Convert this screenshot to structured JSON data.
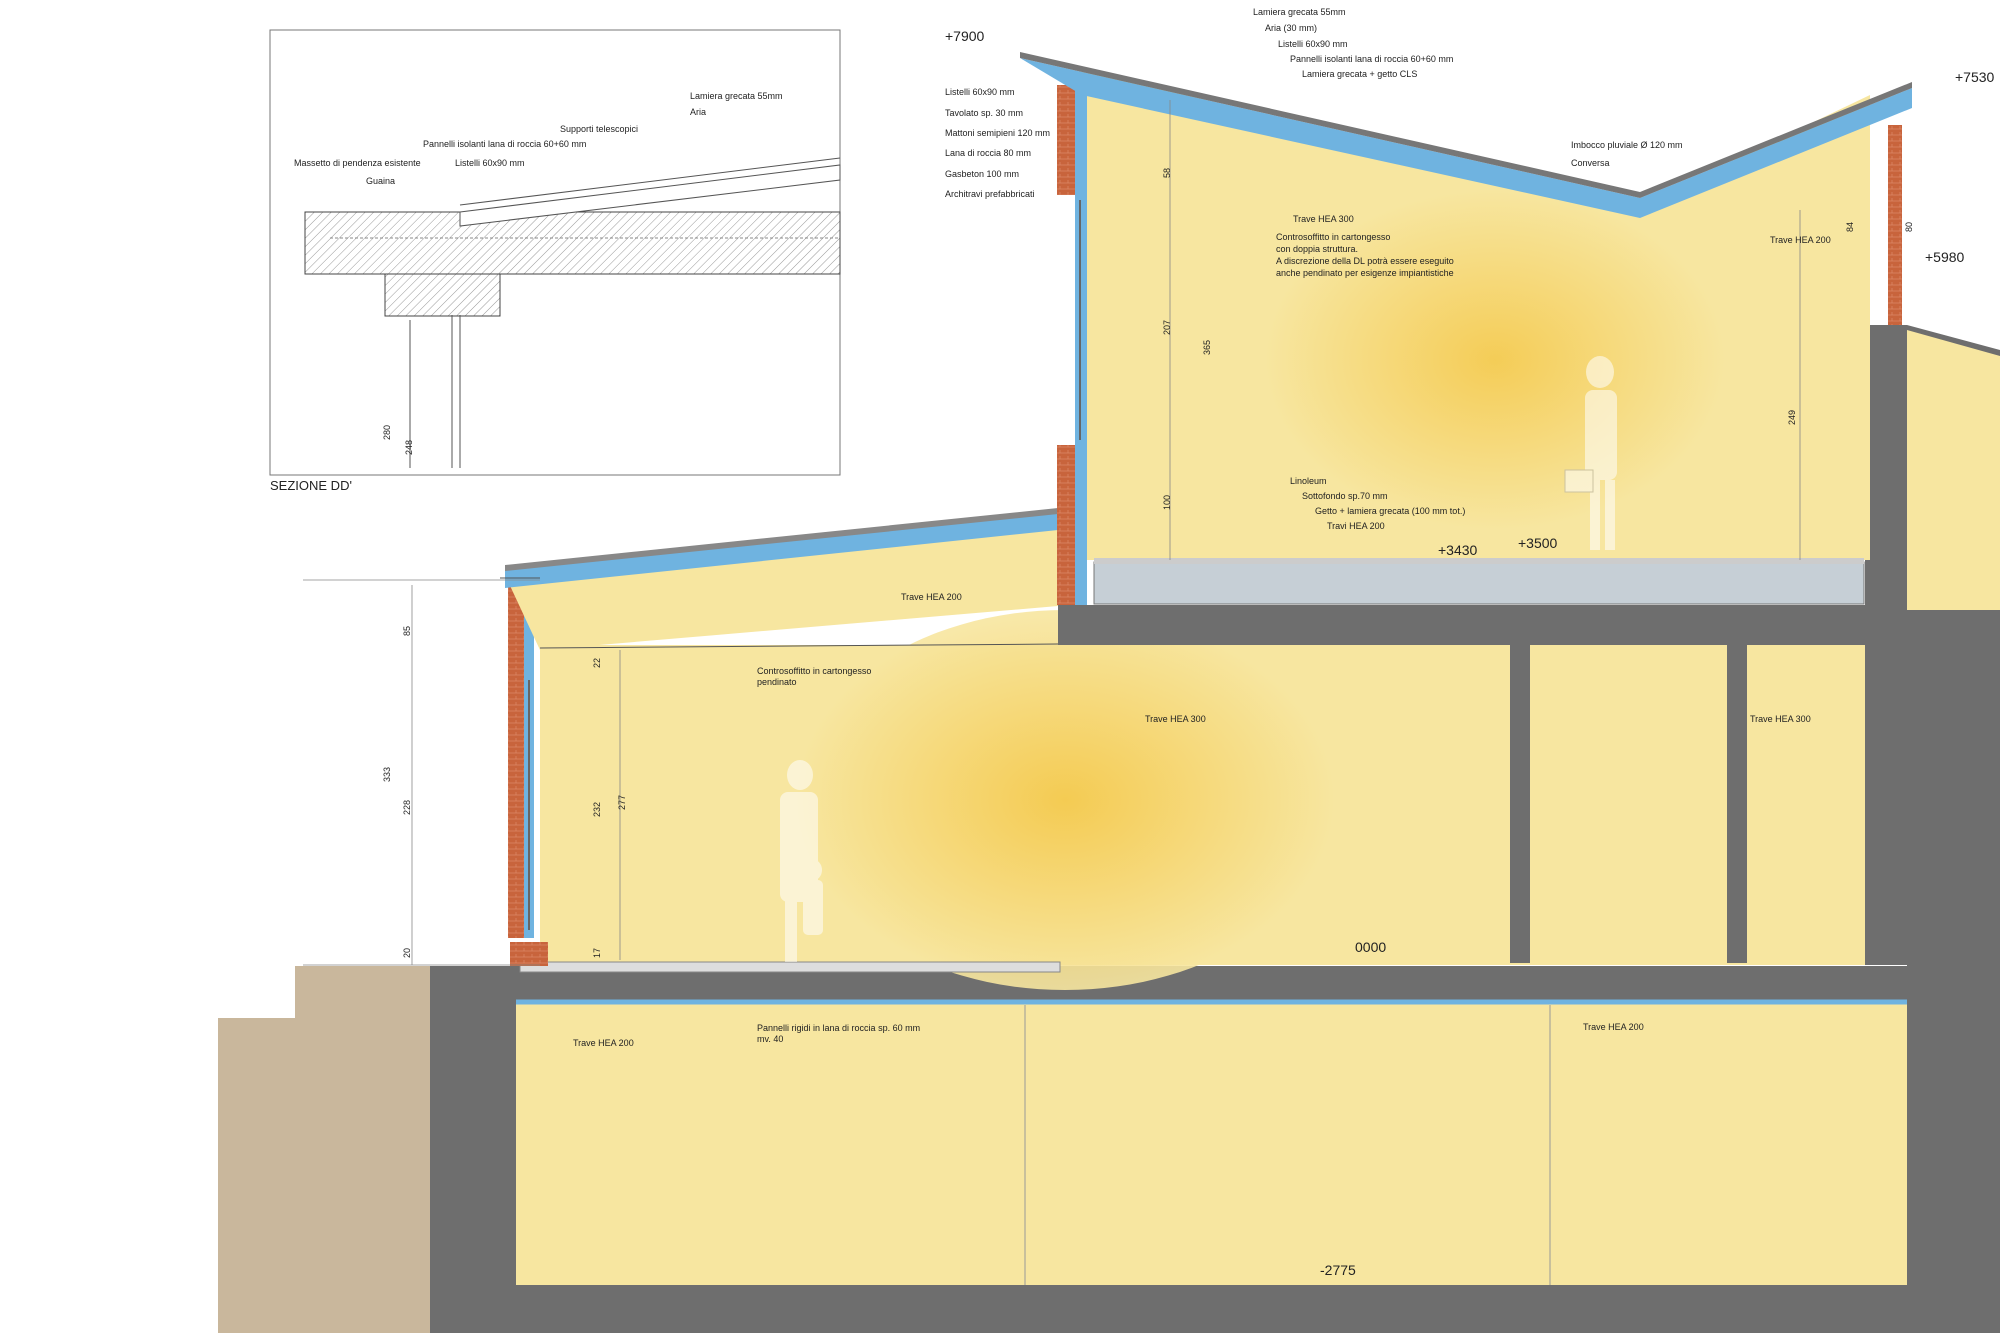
{
  "detail": {
    "title": "SEZIONE DD'",
    "labels": [
      "Lamiera grecata  55mm",
      "Aria",
      "Supporti telescopici",
      "Pannelli isolanti lana di roccia 60+60 mm",
      "Listelli 60x90 mm",
      "Massetto di pendenza esistente",
      "Guaina"
    ],
    "dims": [
      "280",
      "248"
    ]
  },
  "levels": [
    "+7900",
    "+7530",
    "+5980",
    "+3430",
    "+3500",
    "0000",
    "-2775"
  ],
  "roof_left_labels": [
    "Listelli 60x90 mm",
    "Tavolato sp. 30 mm",
    "Mattoni semipieni 120 mm",
    "Lana di roccia 80 mm",
    "Gasbeton 100 mm",
    "Architravi prefabbricati"
  ],
  "roof_top_labels": [
    "Lamiera grecata  55mm",
    "Aria (30 mm)",
    "Listelli 60x90 mm",
    "Pannelli isolanti lana di roccia 60+60 mm",
    "Lamiera grecata + getto CLS"
  ],
  "gutter_labels": [
    "Imbocco pluviale Ø 120 mm",
    "Conversa"
  ],
  "upper_room": {
    "beam_label": "Trave HEA 300",
    "ceiling_lines": [
      "Controsoffitto in cartongesso",
      "con doppia struttura.",
      "A discrezione della DL potrà essere eseguito",
      "anche pendinato per esigenze impiantistiche"
    ],
    "right_beam": "Trave HEA 200",
    "floor_labels": [
      "Linoleum",
      "Sottofondo sp.70 mm",
      "Getto + lamiera grecata (100 mm tot.)",
      "Travi HEA 200"
    ],
    "dims": [
      "58",
      "207",
      "365",
      "100",
      "249",
      "84",
      "80"
    ]
  },
  "lower_room": {
    "beam_label": "Trave HEA 200",
    "ceiling_lines": [
      "Controsoffitto in cartongesso",
      "pendinato"
    ],
    "beam_mid": "Trave HEA 300",
    "beam_right": "Trave HEA 300",
    "dims": [
      "85",
      "333",
      "228",
      "20",
      "22",
      "232",
      "277",
      "17"
    ]
  },
  "basement": {
    "beam_left": "Trave HEA 200",
    "beam_right": "Trave HEA 200",
    "insulation_lines": [
      "Pannelli rigidi in lana di roccia sp. 60 mm",
      "mv. 40"
    ]
  },
  "colors": {
    "wall_fill": "#f7e6a0",
    "glow": "#f4c94a",
    "concrete": "#6e6e6e",
    "brick": "#c8643c",
    "insulation": "#6fb3e0",
    "ground": "#c9b79c"
  }
}
